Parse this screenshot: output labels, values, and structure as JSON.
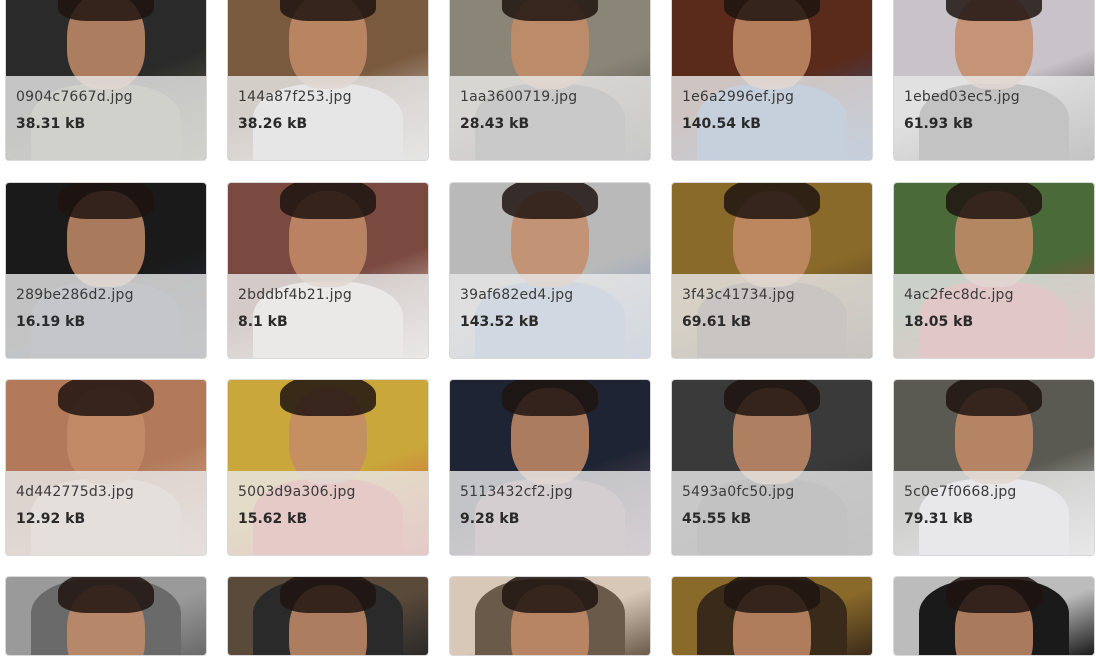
{
  "files": [
    {
      "name": "0904c7667d.jpg",
      "size": "38.31 kB",
      "bg": "#2a2a2a",
      "accent": "#6b6b4a"
    },
    {
      "name": "144a87f253.jpg",
      "size": "38.26 kB",
      "bg": "#7a5a3f",
      "accent": "#dcdcdc"
    },
    {
      "name": "1aa3600719.jpg",
      "size": "28.43 kB",
      "bg": "#8a8576",
      "accent": "#3d3d3d"
    },
    {
      "name": "1e6a2996ef.jpg",
      "size": "140.54 kB",
      "bg": "#5a2a1a",
      "accent": "#2d5fa8"
    },
    {
      "name": "1ebed03ec5.jpg",
      "size": "61.93 kB",
      "bg": "#c9c2c8",
      "accent": "#1f1f1f"
    },
    {
      "name": "289be286d2.jpg",
      "size": "16.19 kB",
      "bg": "#1a1a1a",
      "accent": "#2b3140"
    },
    {
      "name": "2bddbf4b21.jpg",
      "size": "8.1 kB",
      "bg": "#7a4a40",
      "accent": "#f1ece6"
    },
    {
      "name": "39af682ed4.jpg",
      "size": "143.52 kB",
      "bg": "#b9b9b9",
      "accent": "#6d8fc4"
    },
    {
      "name": "3f43c41734.jpg",
      "size": "69.61 kB",
      "bg": "#8a6a2a",
      "accent": "#3a2a1a"
    },
    {
      "name": "4ac2fec8dc.jpg",
      "size": "18.05 kB",
      "bg": "#4a6a3a",
      "accent": "#c8323a"
    },
    {
      "name": "4d442775d3.jpg",
      "size": "12.92 kB",
      "bg": "#b27a5a",
      "accent": "#d9b7a8"
    },
    {
      "name": "5003d9a306.jpg",
      "size": "15.62 kB",
      "bg": "#c9a73a",
      "accent": "#d8433a"
    },
    {
      "name": "5113432cf2.jpg",
      "size": "9.28 kB",
      "bg": "#1e2433",
      "accent": "#7a5a6a"
    },
    {
      "name": "5493a0fc50.jpg",
      "size": "45.55 kB",
      "bg": "#3a3a3a",
      "accent": "#1a1a1a"
    },
    {
      "name": "5c0e7f0668.jpg",
      "size": "79.31 kB",
      "bg": "#5a5a52",
      "accent": "#e8e8f0"
    },
    {
      "name": "",
      "size": "",
      "bg": "#9a9a9a",
      "accent": "#6a6a6a"
    },
    {
      "name": "",
      "size": "",
      "bg": "#5a4a3a",
      "accent": "#2a2a2a"
    },
    {
      "name": "",
      "size": "",
      "bg": "#d8c8b8",
      "accent": "#6a5a4a"
    },
    {
      "name": "",
      "size": "",
      "bg": "#8a6a2a",
      "accent": "#3a2a1a"
    },
    {
      "name": "",
      "size": "",
      "bg": "#bcbcbc",
      "accent": "#1a1a1a"
    }
  ]
}
